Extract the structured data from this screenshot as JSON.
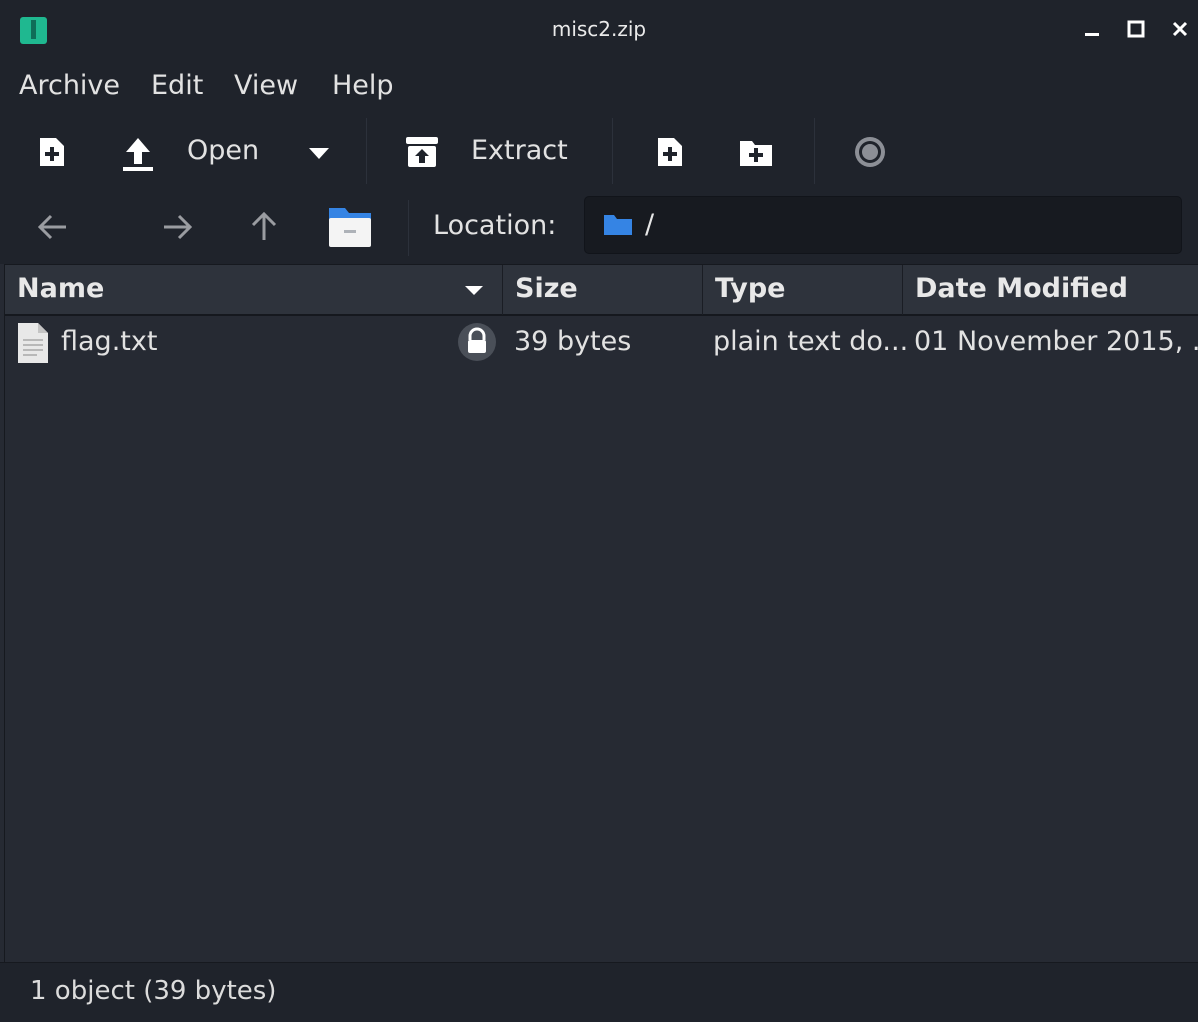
{
  "window": {
    "title": "misc2.zip",
    "app_icon": "archive-manager-icon",
    "controls": [
      "minimize-icon",
      "maximize-icon",
      "close-icon"
    ]
  },
  "menu": {
    "items": [
      "Archive",
      "Edit",
      "View",
      "Help"
    ]
  },
  "toolbar": {
    "open_label": "Open",
    "extract_label": "Extract",
    "icons": [
      "new-archive-icon",
      "open-upload-icon",
      "dropdown-arrow-icon",
      "extract-icon",
      "add-files-icon",
      "add-folder-icon",
      "stop-icon"
    ]
  },
  "navigation": {
    "location_label": "Location:",
    "path": "/",
    "icons": [
      "back-arrow-icon",
      "forward-arrow-icon",
      "up-arrow-icon",
      "home-folder-icon",
      "folder-icon"
    ]
  },
  "table": {
    "columns": [
      "Name",
      "Size",
      "Type",
      "Date Modified"
    ],
    "rows": [
      {
        "name": "flag.txt",
        "size": "39 bytes",
        "type": "plain text do...",
        "modified": "01 November 2015, ...",
        "encrypted": true
      }
    ]
  },
  "status": {
    "text": "1 object (39 bytes)"
  },
  "colors": {
    "background": "#262a33",
    "bar": "#1f232b",
    "accent_folder": "#3584e4",
    "app_icon": "#1fb890"
  }
}
